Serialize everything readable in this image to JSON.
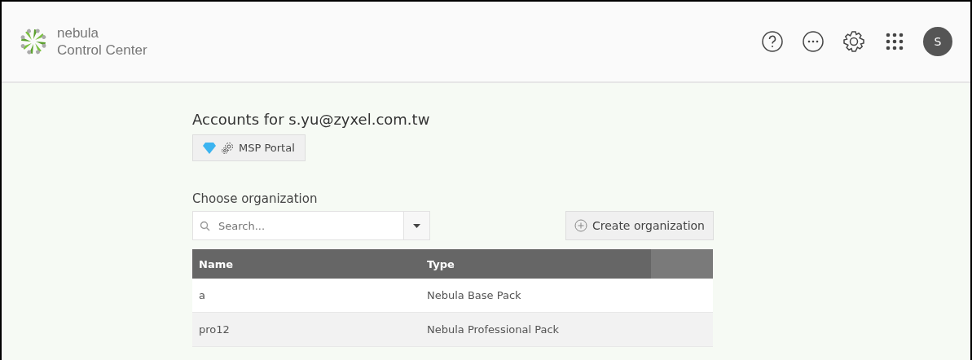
{
  "header": {
    "brand_line_1": "nebula",
    "brand_line_2": "Control Center",
    "avatar_initial": "S"
  },
  "title": "Accounts for s.yu@zyxel.com.tw",
  "msp_button": "MSP Portal",
  "choose_label": "Choose organization",
  "search": {
    "placeholder": "Search..."
  },
  "create_button": "Create organization",
  "table": {
    "columns": [
      "Name",
      "Type"
    ],
    "rows": [
      [
        "a",
        "Nebula Base Pack"
      ],
      [
        "pro12",
        "Nebula Professional Pack"
      ]
    ]
  }
}
